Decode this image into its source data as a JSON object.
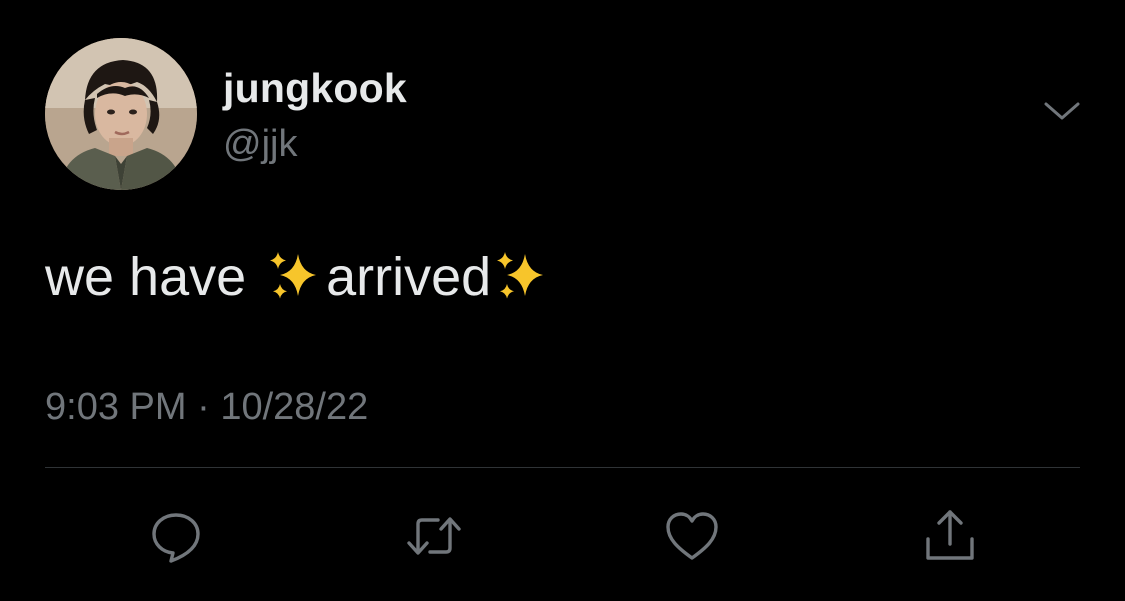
{
  "author": {
    "display_name": "jungkook",
    "handle": "@jjk",
    "avatar": "profile-photo"
  },
  "tweet": {
    "text_part1": "we have",
    "text_part2": "arrived",
    "emoji": "sparkles-icon",
    "time": "9:03 PM",
    "separator": "·",
    "date": "10/28/22"
  },
  "actions": [
    {
      "name": "reply",
      "icon": "speech-bubble-icon"
    },
    {
      "name": "retweet",
      "icon": "retweet-arrows-icon"
    },
    {
      "name": "like",
      "icon": "heart-icon"
    },
    {
      "name": "share",
      "icon": "share-upload-icon"
    }
  ],
  "colors": {
    "background": "#000000",
    "primary_text": "#e7e9ea",
    "secondary_text": "#71767b",
    "divider": "#2f3336",
    "sparkle": "#f7c52b"
  }
}
